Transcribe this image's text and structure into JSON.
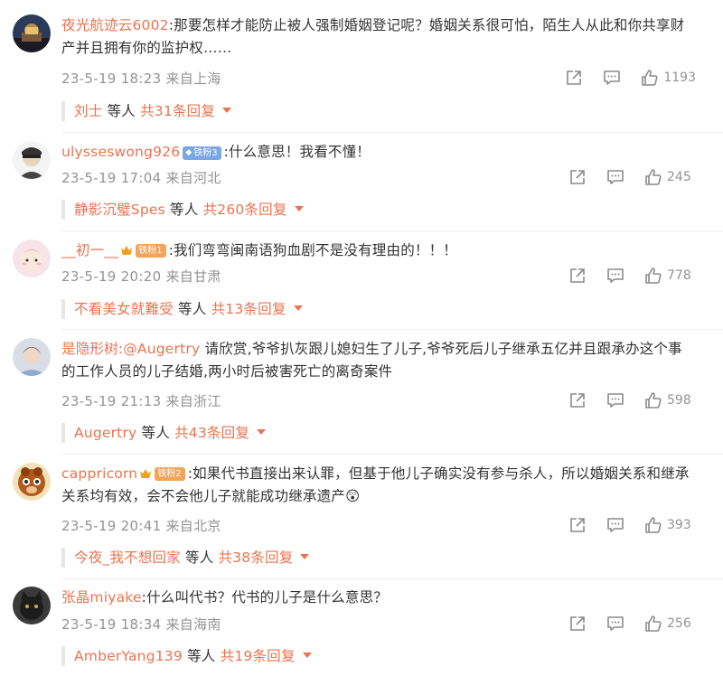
{
  "comments": [
    {
      "user": "夜光航迹云6002",
      "badge": "",
      "text": ":那要怎样才能防止被人强制婚姻登记呢？婚姻关系很可怕，陌生人从此和你共享财产并且拥有你的监护权……",
      "time": "23-5-19 18:23 来自上海",
      "likes": "1193",
      "reply_user": "刘士",
      "reply_mid": "等人",
      "reply_count": "共31条回复"
    },
    {
      "user": "ulysseswong926",
      "badge": "铁粉3",
      "text": ":什么意思！我看不懂！",
      "time": "23-5-19 17:04 来自河北",
      "likes": "245",
      "reply_user": "静影沉璧Spes",
      "reply_mid": "等人",
      "reply_count": "共260条回复"
    },
    {
      "user": "__初一__",
      "badge": "铁粉1",
      "text": ":我们弯弯闽南语狗血剧不是没有理由的！！！",
      "time": "23-5-19 20:20 来自甘肃",
      "likes": "778",
      "reply_user": "不看美女就難受",
      "reply_mid": "等人",
      "reply_count": "共13条回复"
    },
    {
      "user": "是隐形树",
      "badge": "",
      "mention": ":@Augertry",
      "text": " 请欣赏,爷爷扒灰跟儿媳妇生了儿子,爷爷死后儿子继承五亿并且跟承办这个事的工作人员的儿子结婚,两小时后被害死亡的离奇案件",
      "time": "23-5-19 21:13 来自浙江",
      "likes": "598",
      "reply_user": "Augertry",
      "reply_mid": "等人",
      "reply_count": "共43条回复"
    },
    {
      "user": "cappricorn",
      "badge": "铁粉2",
      "text": ":如果代书直接出来认罪，但基于他儿子确实没有参与杀人，所以婚姻关系和继承关系均有效，会不会他儿子就能成功继承遗产",
      "emoji": "😲",
      "time": "23-5-19 20:41 来自北京",
      "likes": "393",
      "reply_user": "今夜_我不想回家",
      "reply_mid": "等人",
      "reply_count": "共38条回复"
    },
    {
      "user": "张晶miyake",
      "badge": "",
      "text": ":什么叫代书？代书的儿子是什么意思？",
      "time": "23-5-19 18:34 来自海南",
      "likes": "256",
      "reply_user": "AmberYang139",
      "reply_mid": "等人",
      "reply_count": "共19条回复"
    }
  ],
  "icons": {
    "share": "share-icon",
    "comment": "comment-icon",
    "like": "thumbs-up-icon"
  },
  "colors": {
    "accent": "#eb7350",
    "meta": "#939393",
    "badge_blue": "#7ba7e6",
    "badge_orange": "#f4a35c"
  }
}
